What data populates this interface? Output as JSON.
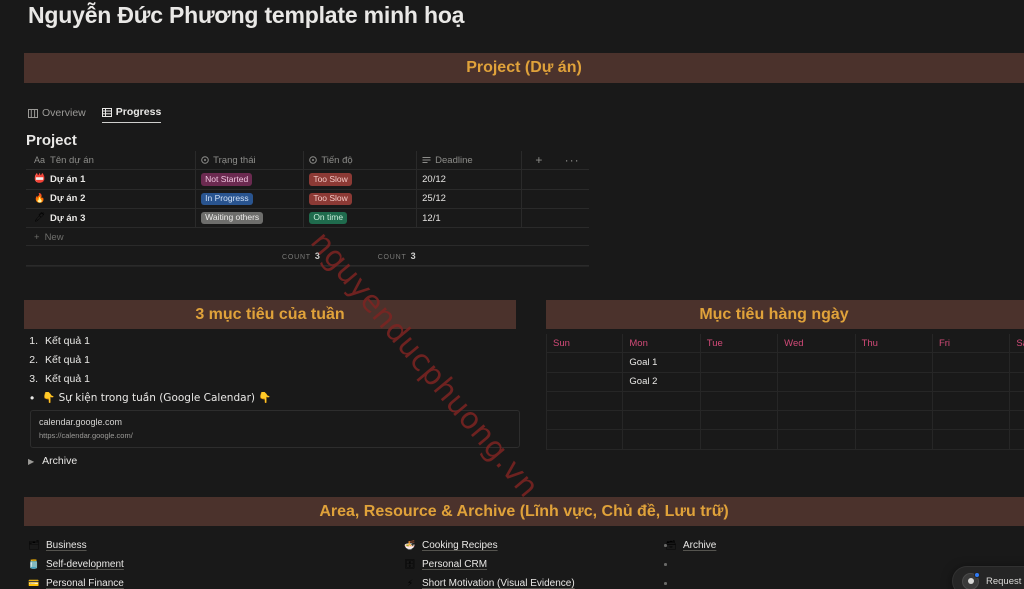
{
  "page": {
    "title": "Nguyễn Đức Phương template minh hoạ",
    "background_color": "#191919",
    "banner_color": "#4b322c",
    "banner_text_color": "#e0a23a",
    "watermark": "nguyenducphuong.vn"
  },
  "banners": {
    "project": "Project (Dự án)",
    "weekly": "3 mục tiêu của tuần",
    "daily": "Mục tiêu hàng ngày",
    "area": "Area, Resource & Archive (Lĩnh vực, Chủ đề, Lưu trữ)"
  },
  "tabs": [
    {
      "label": "Overview",
      "icon": "columns-icon",
      "active": false
    },
    {
      "label": "Progress",
      "icon": "table-icon",
      "active": true
    }
  ],
  "database": {
    "title": "Project",
    "columns": [
      {
        "label": "Tên dự án",
        "icon": "text-type-icon"
      },
      {
        "label": "Trạng thái",
        "icon": "select-icon"
      },
      {
        "label": "Tiến độ",
        "icon": "select-icon"
      },
      {
        "label": "Deadline",
        "icon": "list-icon"
      }
    ],
    "add_column_label": "+",
    "more_options_label": "···",
    "rows": [
      {
        "emoji": "📛",
        "name": "Dự án 1",
        "status": {
          "label": "Not Started",
          "bg": "#6b2a50",
          "fg": "#f0c6e0"
        },
        "progress": {
          "label": "Too Slow",
          "bg": "#8c3a35",
          "fg": "#f2c8c4"
        },
        "deadline": "20/12"
      },
      {
        "emoji": "🔥",
        "name": "Dự án 2",
        "status": {
          "label": "In Progress",
          "bg": "#29548f",
          "fg": "#cfe0f7"
        },
        "progress": {
          "label": "Too Slow",
          "bg": "#8c3a35",
          "fg": "#f2c8c4"
        },
        "deadline": "25/12"
      },
      {
        "emoji": "🖊",
        "name": "Dự án 3",
        "status": {
          "label": "Waiting others",
          "bg": "#6e6e6c",
          "fg": "#ecebe9"
        },
        "progress": {
          "label": "On time",
          "bg": "#1f6b4d",
          "fg": "#c7ecd9"
        },
        "deadline": "12/1"
      }
    ],
    "new_row_label": "New",
    "footer": [
      {
        "label": "COUNT",
        "value": "3"
      },
      {
        "label": "COUNT",
        "value": "3"
      }
    ]
  },
  "weekly_goals": {
    "items": [
      {
        "number": "1.",
        "text": "Kết quả 1"
      },
      {
        "number": "2.",
        "text": "Kết quả 1"
      },
      {
        "number": "3.",
        "text": "Kết quả 1"
      }
    ],
    "bullet": "👇 Sự kiện trong tuần (Google Calendar) 👇",
    "link_preview": {
      "title": "calendar.google.com",
      "url": "https://calendar.google.com/"
    },
    "archive_toggle": "Archive"
  },
  "daily_goals": {
    "day_headers": [
      "Sun",
      "Mon",
      "Tue",
      "Wed",
      "Thu",
      "Fri",
      "Sat"
    ],
    "header_color": "#d24a78",
    "rows": [
      [
        "",
        "Goal 1",
        "",
        "",
        "",
        "",
        ""
      ],
      [
        "",
        "Goal 2",
        "",
        "",
        "",
        "",
        ""
      ],
      [
        "",
        "",
        "",
        "",
        "",
        "",
        ""
      ],
      [
        "",
        "",
        "",
        "",
        "",
        "",
        ""
      ],
      [
        "",
        "",
        "",
        "",
        "",
        "",
        ""
      ]
    ]
  },
  "area_columns": [
    {
      "items": [
        {
          "emoji": "🗂",
          "label": "Business"
        },
        {
          "emoji": "🫙",
          "label": "Self-development"
        },
        {
          "emoji": "💳",
          "label": "Personal Finance"
        }
      ]
    },
    {
      "items": [
        {
          "emoji": "🍜",
          "label": "Cooking Recipes"
        },
        {
          "emoji": "🗄",
          "label": "Personal CRM"
        },
        {
          "emoji": "⚡",
          "label": "Short Motivation (Visual Evidence)"
        }
      ]
    },
    {
      "items": [
        {
          "emoji": "🗃",
          "label": "Archive"
        }
      ],
      "empty_bullets": 2
    }
  ],
  "request_access": {
    "label": "Request acc",
    "avatar_icon": "person-icon",
    "badge_color": "#2f7bf6"
  }
}
